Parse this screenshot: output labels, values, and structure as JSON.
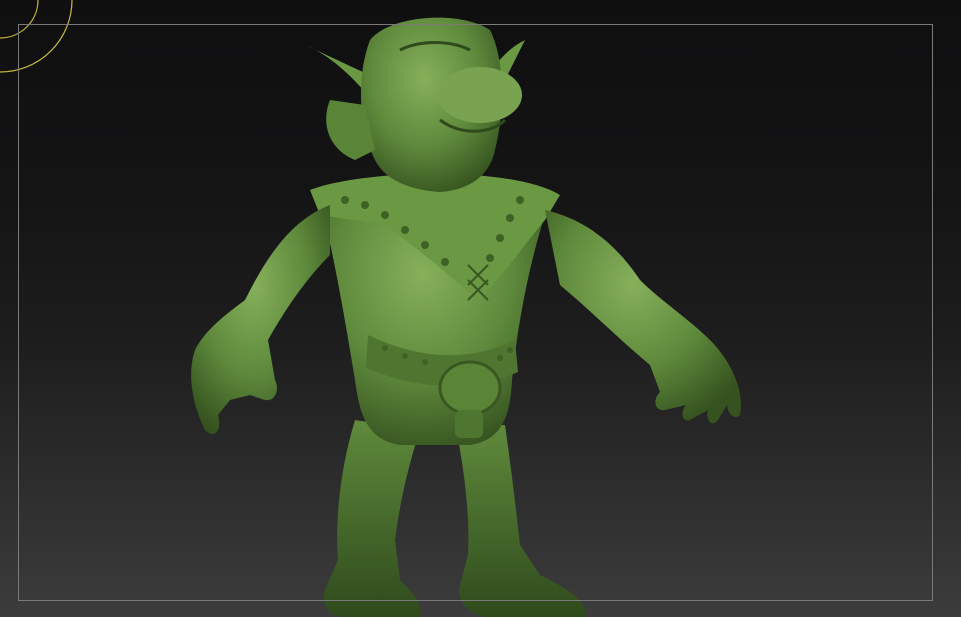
{
  "viewport": {
    "background_top": "#0f0f10",
    "background_bottom": "#3c3c3d",
    "frame_color": "#7a7a7a"
  },
  "gizmo": {
    "icon": "orbit-rings-icon",
    "color": "#c8b83a"
  },
  "model": {
    "icon": "goblin-sculpt",
    "material_color": "#5f8a3c",
    "shadow_color": "#35521f",
    "highlight_color": "#86b05a"
  }
}
